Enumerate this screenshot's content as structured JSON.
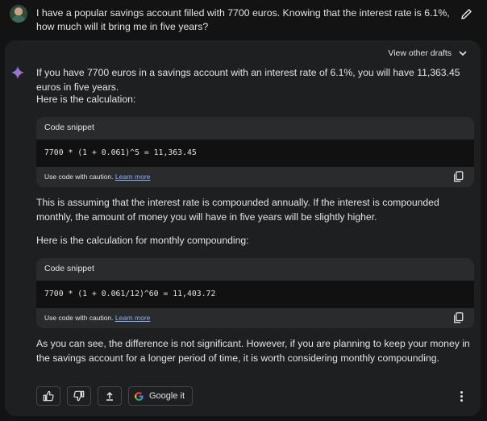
{
  "prompt": {
    "text": "I have a popular savings account filled with 7700 euros. Knowing that the interest rate is 6.1%, how much will it bring me in five years?"
  },
  "response": {
    "view_drafts_label": "View other drafts",
    "para1": "If you have 7700 euros in a savings account with an interest rate of 6.1%, you will have 11,363.45 euros in five years.",
    "para2": "Here is the calculation:",
    "code1": {
      "header": "Code snippet",
      "code": "7700 * (1 + 0.061)^5 = 11,363.45",
      "caution": "Use code with caution.",
      "learn_more": "Learn more"
    },
    "para3": "This is assuming that the interest rate is compounded annually. If the interest is compounded monthly, the amount of money you will have in five years will be slightly higher.",
    "para4": "Here is the calculation for monthly compounding:",
    "code2": {
      "header": "Code snippet",
      "code": "7700 * (1 + 0.061/12)^60 = 11,403.72",
      "caution": "Use code with caution.",
      "learn_more": "Learn more"
    },
    "para5": "As you can see, the difference is not significant. However, if you are planning to keep your money in the savings account for a longer period of time, it is worth considering monthly compounding.",
    "google_it_label": "Google it"
  },
  "icons": {
    "edit": "pencil-icon",
    "drafts": "chevron-down-icon",
    "spark": "gemini-spark-icon",
    "copy": "copy-icon",
    "thumbs_up": "thumbs-up-icon",
    "thumbs_down": "thumbs-down-icon",
    "share": "share-icon",
    "google": "google-g-icon",
    "more": "more-vert-icon"
  },
  "colors": {
    "background": "#131314",
    "card": "#1e1f20",
    "code_header": "#2a2b2d",
    "link": "#8ab4f8",
    "text": "#e3e3e3"
  }
}
